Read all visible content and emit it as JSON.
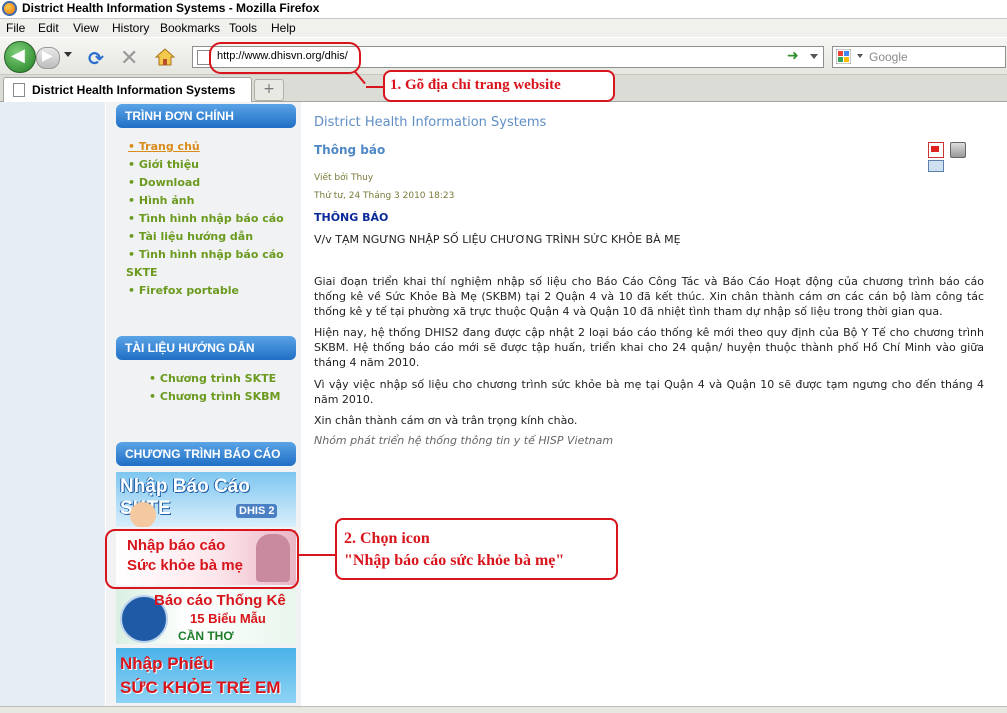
{
  "window": {
    "title": "District Health Information Systems - Mozilla Firefox"
  },
  "menubar": [
    "File",
    "Edit",
    "View",
    "History",
    "Bookmarks",
    "Tools",
    "Help"
  ],
  "navbar": {
    "url": "http://www.dhisvn.org/dhis/",
    "search_placeholder": "Google"
  },
  "tab": {
    "title": "District Health Information Systems",
    "new_tab": "+"
  },
  "sidebar": {
    "main_menu": {
      "header": "TRÌNH ĐƠN CHÍNH",
      "items": [
        {
          "label": "Trang chủ",
          "active": true
        },
        {
          "label": "Giới thiệu"
        },
        {
          "label": "Download"
        },
        {
          "label": "Hình ảnh"
        },
        {
          "label": "Tình hình nhập báo cáo"
        },
        {
          "label": "Tài liệu hướng dẫn"
        },
        {
          "label": "Tình hình nhập báo cáo",
          "label2": "SKTE"
        },
        {
          "label": "Firefox portable"
        }
      ]
    },
    "guides": {
      "header": "TÀI LIỆU HƯỚNG DẪN",
      "items": [
        "Chương trình SKTE",
        "Chương trình SKBM"
      ]
    },
    "programs": {
      "header": "CHƯƠNG TRÌNH BÁO CÁO",
      "banners": [
        {
          "line1": "Nhập Báo Cáo SKTE",
          "badge": "DHIS 2"
        },
        {
          "line1": "Nhập báo cáo",
          "line2": "Sức khỏe bà mẹ"
        },
        {
          "line1": "Báo cáo Thống Kê",
          "line2": "15 Biểu Mẫu",
          "line3": "CẦN THƠ"
        },
        {
          "line1": "Nhập Phiếu",
          "line2": "SỨC KHỎE TRẺ EM"
        }
      ]
    }
  },
  "main": {
    "site_title": "District Health Information Systems",
    "article_heading": "Thông báo",
    "author": "Viết bởi Thuy",
    "date": "Thứ tư, 24 Tháng 3 2010 18:23",
    "notice_title": "THÔNG BÁO",
    "subject": "V/v TẠM NGƯNG NHẬP SỐ LIỆU CHƯƠNG TRÌNH SỨC KHỎE BÀ MẸ",
    "paragraphs": [
      "Giai đoạn triển khai thí nghiệm nhập số liệu cho Báo Cáo Công Tác và Báo Cáo Hoạt động của chương trình báo cáo thống kê về Sức Khỏe Bà Mẹ (SKBM) tại 2 Quận 4 và 10 đã kết thúc. Xin chân thành cám ơn các cán bộ làm công tác thống kê y tế tại phường xã trực thuộc Quận 4 và Quận 10 đã nhiệt tình tham dự nhập số liệu trong thời gian qua.",
      "Hiện nay, hệ thống DHIS2 đang được cập nhật 2 loại báo cáo thống kê mới theo quy định của Bộ Y Tế cho chương trình SKBM. Hệ thống báo cáo mới sẽ được tập huấn, triển khai cho 24 quận/ huyện thuộc thành phố Hồ Chí Minh vào giữa tháng 4 năm 2010.",
      "Vì vậy việc nhập số liệu cho chương trình sức khỏe bà mẹ tại Quận 4 và Quận 10 sẽ được tạm ngưng cho đến tháng 4 năm 2010.",
      " Xin chân thành cám ơn và trân trọng kính chào."
    ],
    "signature": "Nhóm phát triển hệ thống thông tin y tế HISP Vietnam"
  },
  "callouts": {
    "step1": "1. Gõ địa chỉ trang website",
    "step2_line1": "2. Chọn icon",
    "step2_line2": "\"Nhập báo cáo sức khỏe bà mẹ\""
  },
  "colors": {
    "annotation_red": "#d8141c",
    "header_blue": "#1f6fc5",
    "menu_green": "#6b9a1f"
  }
}
